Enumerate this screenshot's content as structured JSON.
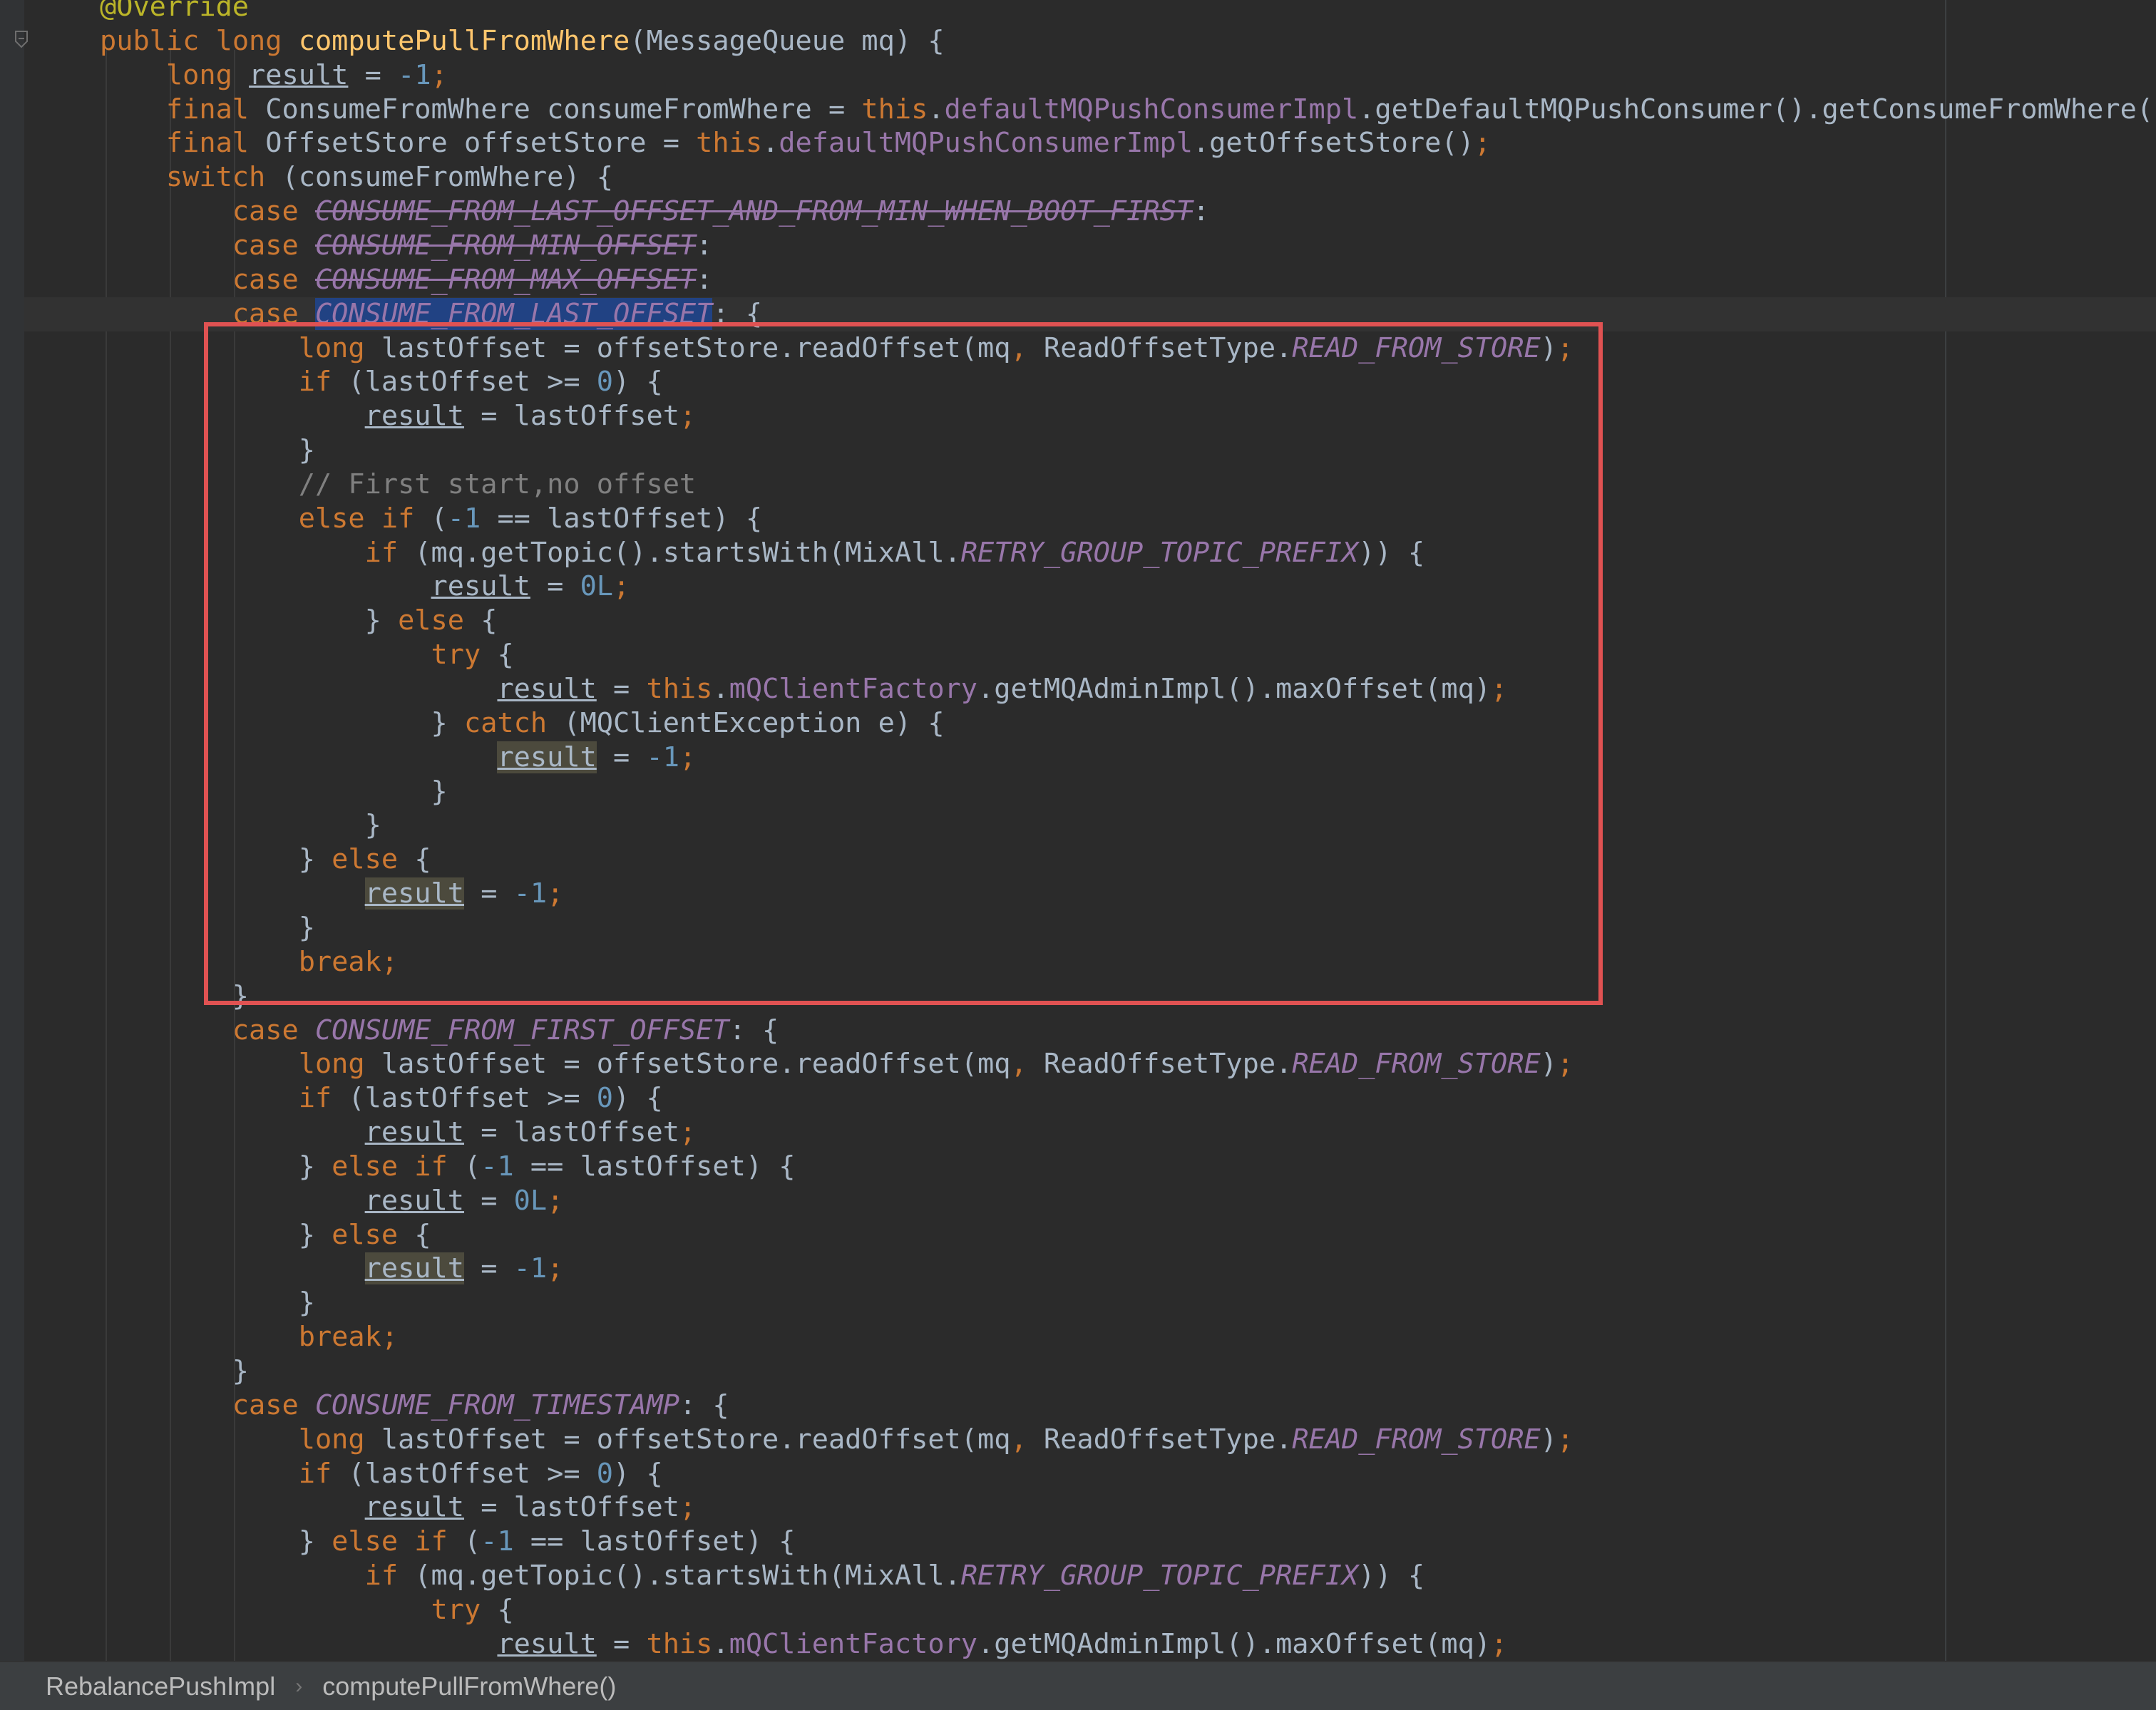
{
  "editor": {
    "lines": [
      {
        "spans": [
          {
            "t": "@Override",
            "c": "anno"
          }
        ]
      },
      {
        "spans": [
          {
            "t": "public ",
            "c": "kw"
          },
          {
            "t": "long ",
            "c": "kw"
          },
          {
            "t": "computePullFromWhere",
            "c": "fn"
          },
          {
            "t": "(MessageQueue mq) {"
          }
        ]
      },
      {
        "spans": [
          {
            "t": "    "
          },
          {
            "t": "long ",
            "c": "kw"
          },
          {
            "t": "result",
            "c": "uvar"
          },
          {
            "t": " = "
          },
          {
            "t": "-1",
            "c": "num"
          },
          {
            "t": ";",
            "c": "kw"
          }
        ]
      },
      {
        "spans": [
          {
            "t": "    "
          },
          {
            "t": "final ",
            "c": "kw"
          },
          {
            "t": "ConsumeFromWhere consumeFromWhere = "
          },
          {
            "t": "this",
            "c": "kw"
          },
          {
            "t": "."
          },
          {
            "t": "defaultMQPushConsumerImpl",
            "c": "field"
          },
          {
            "t": ".getDefaultMQPushConsumer().getConsumeFromWhere()"
          },
          {
            "t": ";",
            "c": "kw"
          }
        ]
      },
      {
        "spans": [
          {
            "t": "    "
          },
          {
            "t": "final ",
            "c": "kw"
          },
          {
            "t": "OffsetStore offsetStore = "
          },
          {
            "t": "this",
            "c": "kw"
          },
          {
            "t": "."
          },
          {
            "t": "defaultMQPushConsumerImpl",
            "c": "field"
          },
          {
            "t": ".getOffsetStore()"
          },
          {
            "t": ";",
            "c": "kw"
          }
        ]
      },
      {
        "spans": [
          {
            "t": "    "
          },
          {
            "t": "switch ",
            "c": "kw"
          },
          {
            "t": "(consumeFromWhere) {"
          }
        ]
      },
      {
        "spans": [
          {
            "t": "        "
          },
          {
            "t": "case ",
            "c": "kw"
          },
          {
            "t": "CONSUME_FROM_LAST_OFFSET_AND_FROM_MIN_WHEN_BOOT_FIRST",
            "c": "deprecated"
          },
          {
            "t": ":"
          }
        ]
      },
      {
        "spans": [
          {
            "t": "        "
          },
          {
            "t": "case ",
            "c": "kw"
          },
          {
            "t": "CONSUME_FROM_MIN_OFFSET",
            "c": "deprecated"
          },
          {
            "t": ":"
          }
        ]
      },
      {
        "spans": [
          {
            "t": "        "
          },
          {
            "t": "case ",
            "c": "kw"
          },
          {
            "t": "CONSUME_FROM_MAX_OFFSET",
            "c": "deprecated"
          },
          {
            "t": ":"
          }
        ]
      },
      {
        "current": true,
        "spans": [
          {
            "t": "        "
          },
          {
            "t": "case ",
            "c": "kw"
          },
          {
            "t": "CONSUME_FROM_LAST_OFFSET",
            "c": "const hl-select"
          },
          {
            "t": ": {"
          }
        ]
      },
      {
        "spans": [
          {
            "t": "            "
          },
          {
            "t": "long ",
            "c": "kw"
          },
          {
            "t": "lastOffset = offsetStore.readOffset(mq"
          },
          {
            "t": ", ",
            "c": "kw"
          },
          {
            "t": "ReadOffsetType."
          },
          {
            "t": "READ_FROM_STORE",
            "c": "const"
          },
          {
            "t": ")"
          },
          {
            "t": ";",
            "c": "kw"
          }
        ]
      },
      {
        "spans": [
          {
            "t": "            "
          },
          {
            "t": "if ",
            "c": "kw"
          },
          {
            "t": "(lastOffset >= "
          },
          {
            "t": "0",
            "c": "num"
          },
          {
            "t": ") {"
          }
        ]
      },
      {
        "spans": [
          {
            "t": "                "
          },
          {
            "t": "result",
            "c": "uvar"
          },
          {
            "t": " = lastOffset"
          },
          {
            "t": ";",
            "c": "kw"
          }
        ]
      },
      {
        "spans": [
          {
            "t": "            }"
          }
        ]
      },
      {
        "spans": [
          {
            "t": "            "
          },
          {
            "t": "// First start,no offset",
            "c": "cmt"
          }
        ]
      },
      {
        "spans": [
          {
            "t": "            "
          },
          {
            "t": "else if ",
            "c": "kw"
          },
          {
            "t": "("
          },
          {
            "t": "-1",
            "c": "num"
          },
          {
            "t": " == lastOffset) {"
          }
        ]
      },
      {
        "spans": [
          {
            "t": "                "
          },
          {
            "t": "if ",
            "c": "kw"
          },
          {
            "t": "(mq.getTopic().startsWith(MixAll."
          },
          {
            "t": "RETRY_GROUP_TOPIC_PREFIX",
            "c": "const"
          },
          {
            "t": ")) {"
          }
        ]
      },
      {
        "spans": [
          {
            "t": "                    "
          },
          {
            "t": "result",
            "c": "uvar"
          },
          {
            "t": " = "
          },
          {
            "t": "0L",
            "c": "num"
          },
          {
            "t": ";",
            "c": "kw"
          }
        ]
      },
      {
        "spans": [
          {
            "t": "                } "
          },
          {
            "t": "else ",
            "c": "kw"
          },
          {
            "t": "{"
          }
        ]
      },
      {
        "spans": [
          {
            "t": "                    "
          },
          {
            "t": "try ",
            "c": "kw"
          },
          {
            "t": "{"
          }
        ]
      },
      {
        "spans": [
          {
            "t": "                        "
          },
          {
            "t": "result",
            "c": "uvar"
          },
          {
            "t": " = "
          },
          {
            "t": "this",
            "c": "kw"
          },
          {
            "t": "."
          },
          {
            "t": "mQClientFactory",
            "c": "field"
          },
          {
            "t": ".getMQAdminImpl().maxOffset(mq)"
          },
          {
            "t": ";",
            "c": "kw"
          }
        ]
      },
      {
        "spans": [
          {
            "t": "                    } "
          },
          {
            "t": "catch ",
            "c": "kw"
          },
          {
            "t": "(MQClientException e) {"
          }
        ]
      },
      {
        "spans": [
          {
            "t": "                        "
          },
          {
            "t": "result",
            "c": "uvar hl-usage"
          },
          {
            "t": " = "
          },
          {
            "t": "-1",
            "c": "num"
          },
          {
            "t": ";",
            "c": "kw"
          }
        ]
      },
      {
        "spans": [
          {
            "t": "                    }"
          }
        ]
      },
      {
        "spans": [
          {
            "t": "                }"
          }
        ]
      },
      {
        "spans": [
          {
            "t": "            } "
          },
          {
            "t": "else ",
            "c": "kw"
          },
          {
            "t": "{"
          }
        ]
      },
      {
        "spans": [
          {
            "t": "                "
          },
          {
            "t": "result",
            "c": "uvar hl-usage"
          },
          {
            "t": " = "
          },
          {
            "t": "-1",
            "c": "num"
          },
          {
            "t": ";",
            "c": "kw"
          }
        ]
      },
      {
        "spans": [
          {
            "t": "            }"
          }
        ]
      },
      {
        "spans": [
          {
            "t": "            "
          },
          {
            "t": "break;",
            "c": "kw"
          }
        ]
      },
      {
        "spans": [
          {
            "t": "        }"
          }
        ]
      },
      {
        "spans": [
          {
            "t": "        "
          },
          {
            "t": "case ",
            "c": "kw"
          },
          {
            "t": "CONSUME_FROM_FIRST_OFFSET",
            "c": "const"
          },
          {
            "t": ": {"
          }
        ]
      },
      {
        "spans": [
          {
            "t": "            "
          },
          {
            "t": "long ",
            "c": "kw"
          },
          {
            "t": "lastOffset = offsetStore.readOffset(mq"
          },
          {
            "t": ", ",
            "c": "kw"
          },
          {
            "t": "ReadOffsetType."
          },
          {
            "t": "READ_FROM_STORE",
            "c": "const"
          },
          {
            "t": ")"
          },
          {
            "t": ";",
            "c": "kw"
          }
        ]
      },
      {
        "spans": [
          {
            "t": "            "
          },
          {
            "t": "if ",
            "c": "kw"
          },
          {
            "t": "(lastOffset >= "
          },
          {
            "t": "0",
            "c": "num"
          },
          {
            "t": ") {"
          }
        ]
      },
      {
        "spans": [
          {
            "t": "                "
          },
          {
            "t": "result",
            "c": "uvar"
          },
          {
            "t": " = lastOffset"
          },
          {
            "t": ";",
            "c": "kw"
          }
        ]
      },
      {
        "spans": [
          {
            "t": "            } "
          },
          {
            "t": "else if ",
            "c": "kw"
          },
          {
            "t": "("
          },
          {
            "t": "-1",
            "c": "num"
          },
          {
            "t": " == lastOffset) {"
          }
        ]
      },
      {
        "spans": [
          {
            "t": "                "
          },
          {
            "t": "result",
            "c": "uvar"
          },
          {
            "t": " = "
          },
          {
            "t": "0L",
            "c": "num"
          },
          {
            "t": ";",
            "c": "kw"
          }
        ]
      },
      {
        "spans": [
          {
            "t": "            } "
          },
          {
            "t": "else ",
            "c": "kw"
          },
          {
            "t": "{"
          }
        ]
      },
      {
        "spans": [
          {
            "t": "                "
          },
          {
            "t": "result",
            "c": "uvar hl-usage"
          },
          {
            "t": " = "
          },
          {
            "t": "-1",
            "c": "num"
          },
          {
            "t": ";",
            "c": "kw"
          }
        ]
      },
      {
        "spans": [
          {
            "t": "            }"
          }
        ]
      },
      {
        "spans": [
          {
            "t": "            "
          },
          {
            "t": "break;",
            "c": "kw"
          }
        ]
      },
      {
        "spans": [
          {
            "t": "        }"
          }
        ]
      },
      {
        "spans": [
          {
            "t": "        "
          },
          {
            "t": "case ",
            "c": "kw"
          },
          {
            "t": "CONSUME_FROM_TIMESTAMP",
            "c": "const"
          },
          {
            "t": ": {"
          }
        ]
      },
      {
        "spans": [
          {
            "t": "            "
          },
          {
            "t": "long ",
            "c": "kw"
          },
          {
            "t": "lastOffset = offsetStore.readOffset(mq"
          },
          {
            "t": ", ",
            "c": "kw"
          },
          {
            "t": "ReadOffsetType."
          },
          {
            "t": "READ_FROM_STORE",
            "c": "const"
          },
          {
            "t": ")"
          },
          {
            "t": ";",
            "c": "kw"
          }
        ]
      },
      {
        "spans": [
          {
            "t": "            "
          },
          {
            "t": "if ",
            "c": "kw"
          },
          {
            "t": "(lastOffset >= "
          },
          {
            "t": "0",
            "c": "num"
          },
          {
            "t": ") {"
          }
        ]
      },
      {
        "spans": [
          {
            "t": "                "
          },
          {
            "t": "result",
            "c": "uvar"
          },
          {
            "t": " = lastOffset"
          },
          {
            "t": ";",
            "c": "kw"
          }
        ]
      },
      {
        "spans": [
          {
            "t": "            } "
          },
          {
            "t": "else if ",
            "c": "kw"
          },
          {
            "t": "("
          },
          {
            "t": "-1",
            "c": "num"
          },
          {
            "t": " == lastOffset) {"
          }
        ]
      },
      {
        "spans": [
          {
            "t": "                "
          },
          {
            "t": "if ",
            "c": "kw"
          },
          {
            "t": "(mq.getTopic().startsWith(MixAll."
          },
          {
            "t": "RETRY_GROUP_TOPIC_PREFIX",
            "c": "const"
          },
          {
            "t": ")) {"
          }
        ]
      },
      {
        "spans": [
          {
            "t": "                    "
          },
          {
            "t": "try ",
            "c": "kw"
          },
          {
            "t": "{"
          }
        ]
      },
      {
        "spans": [
          {
            "t": "                        "
          },
          {
            "t": "result",
            "c": "uvar"
          },
          {
            "t": " = "
          },
          {
            "t": "this",
            "c": "kw"
          },
          {
            "t": "."
          },
          {
            "t": "mQClientFactory",
            "c": "field"
          },
          {
            "t": ".getMQAdminImpl().maxOffset(mq)"
          },
          {
            "t": ";",
            "c": "kw"
          }
        ]
      }
    ]
  },
  "breadcrumb": {
    "class_name": "RebalancePushImpl",
    "separator": "›",
    "method_name": "computePullFromWhere()"
  },
  "colors": {
    "background": "#2b2b2b",
    "keyword": "#cc7832",
    "method": "#ffc66d",
    "field_constant": "#9876aa",
    "number": "#6897bb",
    "comment": "#808080",
    "annotation": "#bbb529",
    "text": "#a9b7c6",
    "annotation_box": "#e05252"
  },
  "icons": {
    "gutter_fold": "fold-marker-icon"
  }
}
